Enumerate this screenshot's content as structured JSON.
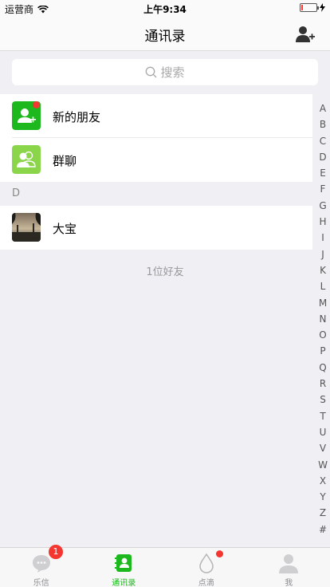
{
  "status": {
    "carrier": "运营商",
    "time": "上午9:34",
    "battery_level": 0.12
  },
  "header": {
    "title": "通讯录",
    "add_friend_icon": "add-user-icon"
  },
  "search": {
    "placeholder": "搜索",
    "icon": "search-icon"
  },
  "rows": [
    {
      "label": "新的朋友",
      "icon": "new-friend-icon",
      "has_dot": true
    },
    {
      "label": "群聊",
      "icon": "group-chat-icon"
    }
  ],
  "sections": [
    {
      "letter": "D",
      "contacts": [
        {
          "name": "大宝"
        }
      ]
    }
  ],
  "count_text": "1位好友",
  "index_letters": [
    "A",
    "B",
    "C",
    "D",
    "E",
    "F",
    "G",
    "H",
    "I",
    "J",
    "K",
    "L",
    "M",
    "N",
    "O",
    "P",
    "Q",
    "R",
    "S",
    "T",
    "U",
    "V",
    "W",
    "X",
    "Y",
    "Z",
    "#"
  ],
  "tabs": [
    {
      "label": "乐信",
      "icon": "chat-bubble-icon",
      "badge": "1",
      "active": false
    },
    {
      "label": "通讯录",
      "icon": "contacts-book-icon",
      "active": true
    },
    {
      "label": "点滴",
      "icon": "droplet-icon",
      "active": false
    },
    {
      "label": "我",
      "icon": "person-icon",
      "active": false
    }
  ],
  "colors": {
    "accent": "#1db81d",
    "badge": "#f43530",
    "group_icon": "#8bd54a"
  }
}
